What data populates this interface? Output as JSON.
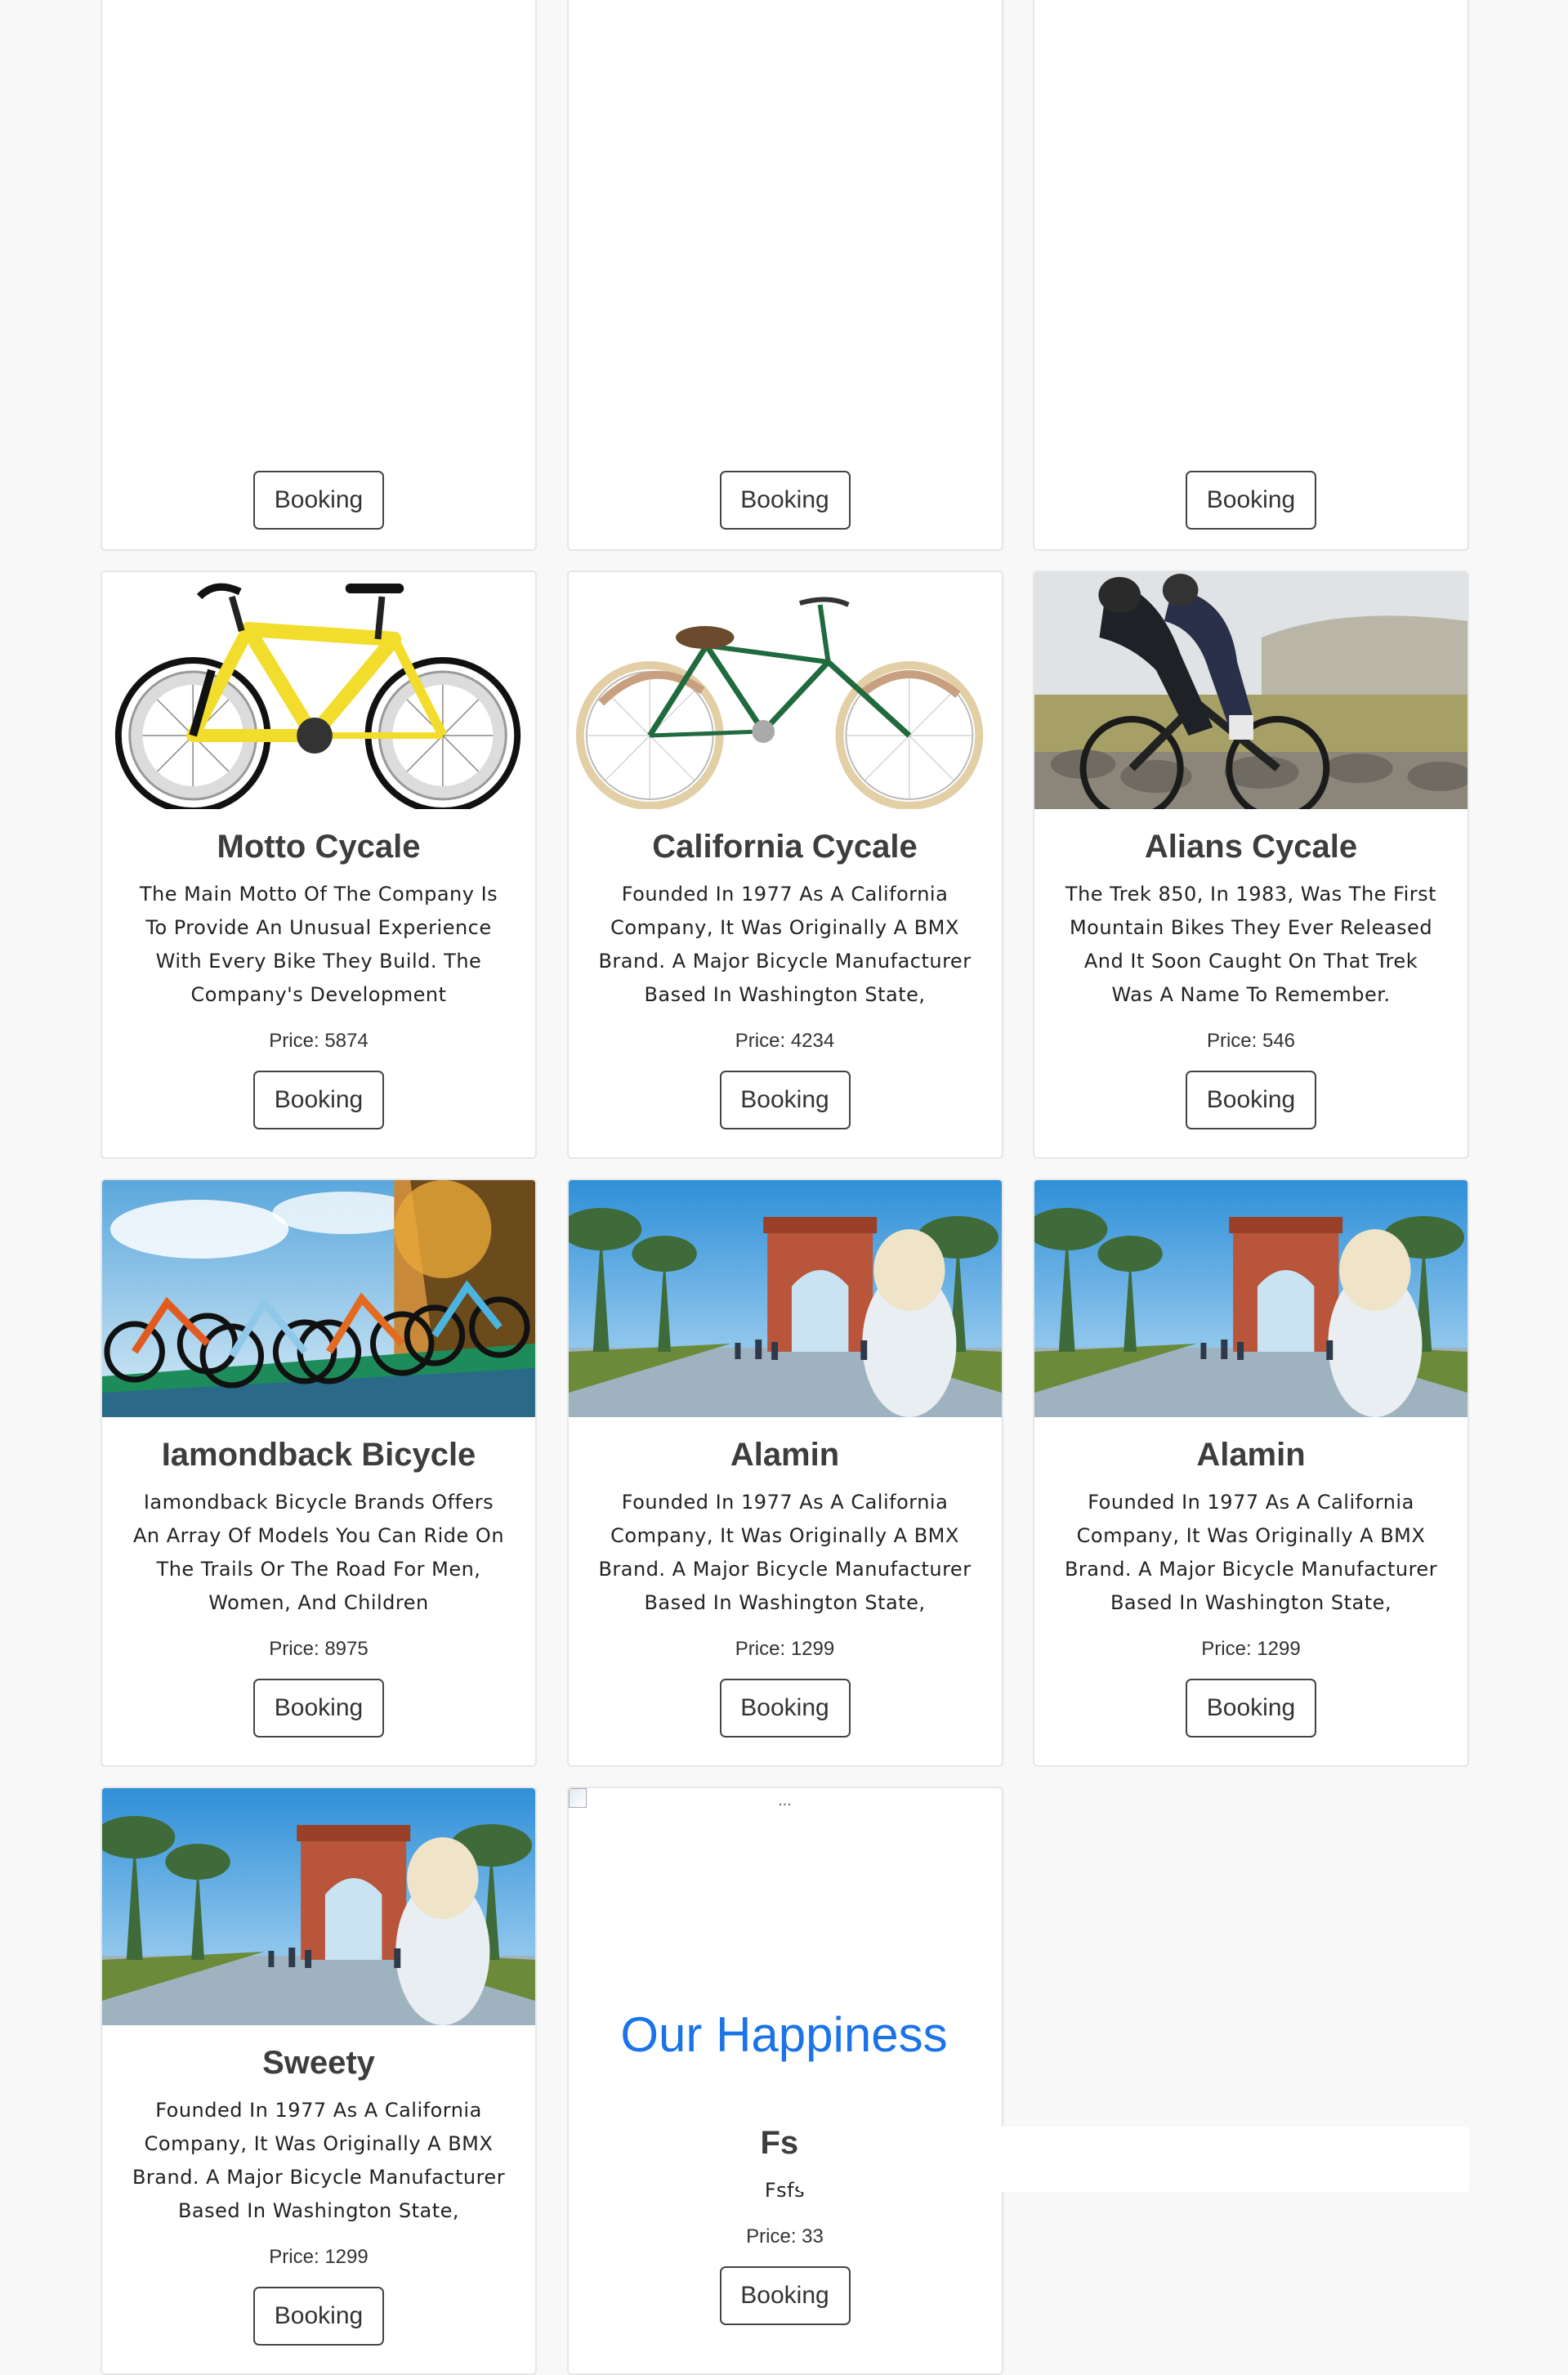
{
  "button_label": "Booking",
  "price_prefix": "Price: ",
  "cards": [
    {
      "title": "",
      "desc": "",
      "price": "",
      "image": "partial-card-top"
    },
    {
      "title": "",
      "desc": "",
      "price": "",
      "image": "partial-card-top"
    },
    {
      "title": "",
      "desc": "",
      "price": "",
      "image": "partial-card-top"
    },
    {
      "title": "Motto Cycale",
      "desc": "The Main Motto Of The Company Is To Provide An Unusual Experience With Every Bike They Build. The Company's Development",
      "price": "5874",
      "image": "yellow-road-bike-photo"
    },
    {
      "title": "California Cycale",
      "desc": "Founded In 1977 As A California Company, It Was Originally A BMX Brand. A Major Bicycle Manufacturer Based In Washington State,",
      "price": "4234",
      "image": "green-city-bike-photo"
    },
    {
      "title": "Alians Cycale",
      "desc": "The Trek 850, In 1983, Was The First Mountain Bikes They Ever Released And It Soon Caught On That Trek Was A Name To Remember.",
      "price": "546",
      "image": "cyclists-riding-photo"
    },
    {
      "title": "Iamondback Bicycle",
      "desc": "Iamondback Bicycle Brands Offers An Array Of Models You Can Ride On The Trails Or The Road For Men, Women, And Children",
      "price": "8975",
      "image": "four-bikes-forest-photo"
    },
    {
      "title": "Alamin",
      "desc": "Founded In 1977 As A California Company, It Was Originally A BMX Brand. A Major Bicycle Manufacturer Based In Washington State,",
      "price": "1299",
      "image": "arc-de-triomf-photo"
    },
    {
      "title": "Alamin",
      "desc": "Founded In 1977 As A California Company, It Was Originally A BMX Brand. A Major Bicycle Manufacturer Based In Washington State,",
      "price": "1299",
      "image": "arc-de-triomf-photo"
    },
    {
      "title": "Sweety",
      "desc": "Founded In 1977 As A California Company, It Was Originally A BMX Brand. A Major Bicycle Manufacturer Based In Washington State,",
      "price": "1299",
      "image": "arc-de-triomf-photo"
    },
    {
      "title": "Fsf",
      "desc": "Fsfs",
      "price": "33",
      "image": "broken-image",
      "image_alt": "..."
    }
  ],
  "section": {
    "title": "Our Happiness"
  },
  "colors": {
    "accent": "#1a73e8",
    "page_bg": "#f8f8f8",
    "card_border": "#e6e6e6"
  }
}
